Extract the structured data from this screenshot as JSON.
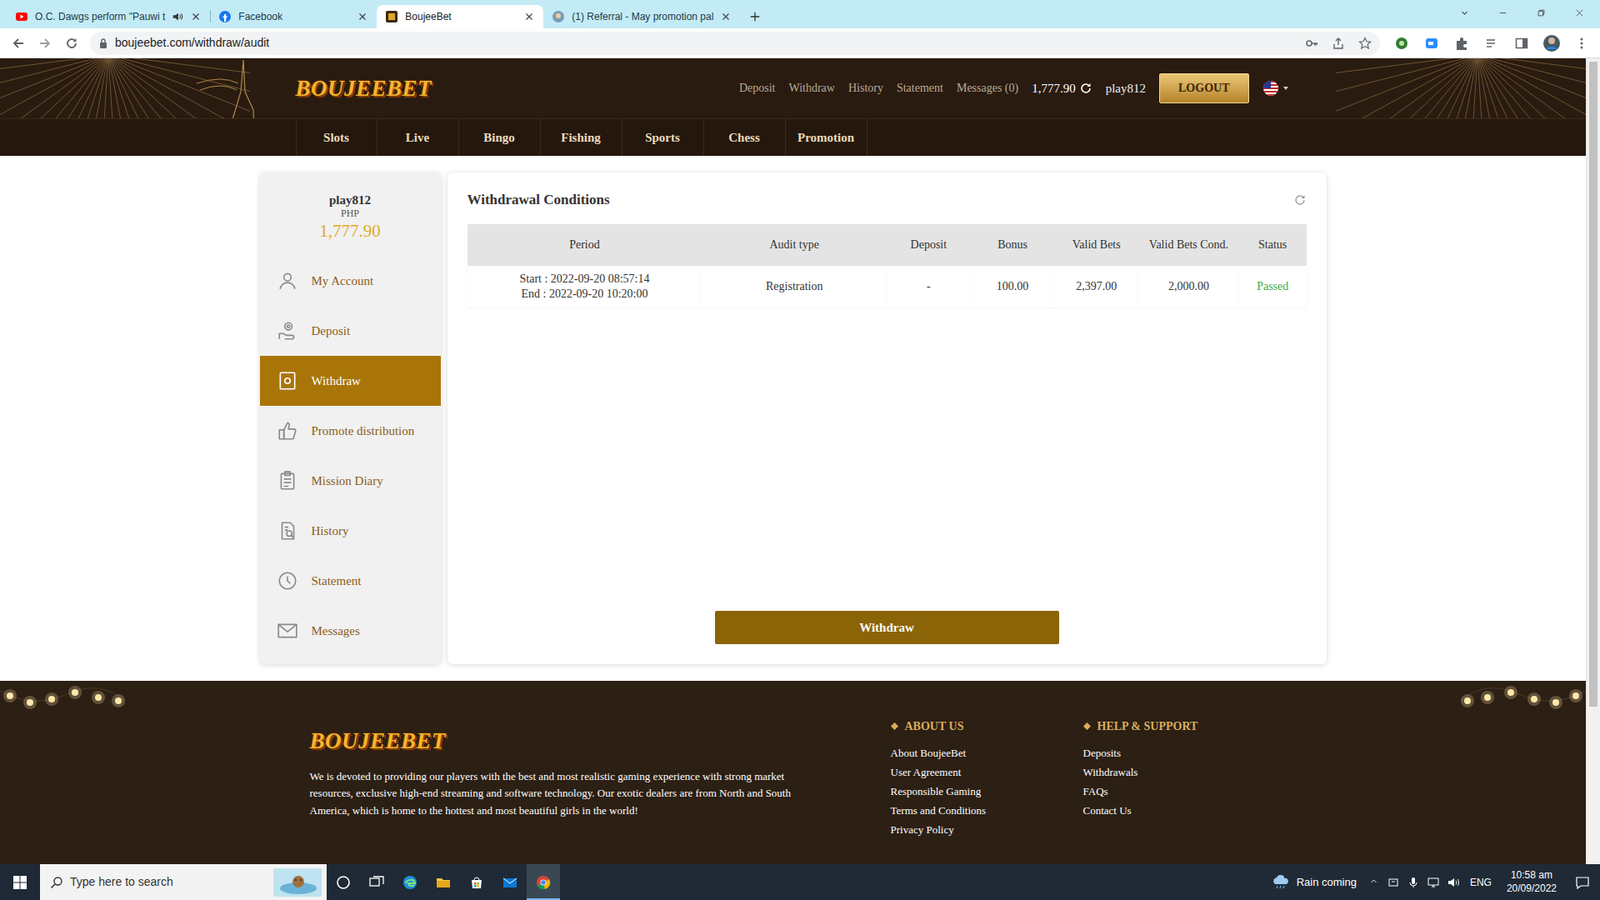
{
  "browser": {
    "tabs": [
      {
        "label": "O.C. Dawgs perform \"Pauwi t",
        "selected": false,
        "audio": true,
        "kind": "youtube"
      },
      {
        "label": "Facebook",
        "selected": false,
        "audio": false,
        "kind": "facebook"
      },
      {
        "label": "BoujeeBet",
        "selected": true,
        "audio": false,
        "kind": "boujeebet"
      },
      {
        "label": "(1) Referral - May promotion pal",
        "selected": false,
        "audio": false,
        "kind": "referral"
      }
    ],
    "address": "boujeebet.com/withdraw/audit"
  },
  "site": {
    "logo": "BOUJEEBET",
    "top_links": [
      "Deposit",
      "Withdraw",
      "History",
      "Statement",
      "Messages (0)"
    ],
    "balance": "1,777.90",
    "username": "play812",
    "logout": "LOGOUT",
    "nav": [
      "Slots",
      "Live",
      "Bingo",
      "Fishing",
      "Sports",
      "Chess",
      "Promotion"
    ]
  },
  "sidebar": {
    "username": "play812",
    "currency": "PHP",
    "balance": "1,777.90",
    "items": [
      {
        "label": "My Account",
        "selected": false,
        "kind": "account"
      },
      {
        "label": "Deposit",
        "selected": false,
        "kind": "deposit"
      },
      {
        "label": "Withdraw",
        "selected": true,
        "kind": "withdraw"
      },
      {
        "label": "Promote distribution",
        "selected": false,
        "kind": "promote"
      },
      {
        "label": "Mission Diary",
        "selected": false,
        "kind": "mission"
      },
      {
        "label": "History",
        "selected": false,
        "kind": "history"
      },
      {
        "label": "Statement",
        "selected": false,
        "kind": "statement"
      },
      {
        "label": "Messages",
        "selected": false,
        "kind": "messages"
      }
    ]
  },
  "panel": {
    "title": "Withdrawal Conditions",
    "table": {
      "columns": [
        "Period",
        "Audit type",
        "Deposit",
        "Bonus",
        "Valid Bets",
        "Valid Bets Cond.",
        "Status"
      ],
      "rows": [
        {
          "start": "Start : 2022-09-20 08:57:14",
          "end": "End : 2022-09-20 10:20:00",
          "audit_type": "Registration",
          "deposit": "-",
          "bonus": "100.00",
          "valid_bets": "2,397.00",
          "valid_bets_cond": "2,000.00",
          "status": "Passed",
          "passed": true
        }
      ]
    },
    "button": "Withdraw"
  },
  "footer": {
    "logo": "BOUJEEBET",
    "description": "We is devoted to providing our players with the best and most realistic gaming experience with strong market resources, exclusive high-end streaming and software technology. Our exotic dealers are from North and South America, which is home to the hottest and most beautiful girls in the world!",
    "columns": [
      {
        "title": "ABOUT US",
        "links": [
          "About BoujeeBet",
          "User Agreement",
          "Responsible Gaming",
          "Terms and Conditions",
          "Privacy Policy"
        ]
      },
      {
        "title": "HELP & SUPPORT",
        "links": [
          "Deposits",
          "Withdrawals",
          "FAQs",
          "Contact Us"
        ]
      }
    ]
  },
  "taskbar": {
    "search_placeholder": "Type here to search",
    "apps": [
      {
        "kind": "cortana",
        "active": false
      },
      {
        "kind": "taskview",
        "active": false
      },
      {
        "kind": "edge",
        "active": false
      },
      {
        "kind": "explorer",
        "active": false
      },
      {
        "kind": "store",
        "active": false
      },
      {
        "kind": "mail",
        "active": false
      },
      {
        "kind": "chrome",
        "active": true
      }
    ],
    "weather": "Rain coming",
    "language": "ENG",
    "time": "10:58 am",
    "date": "20/09/2022"
  }
}
